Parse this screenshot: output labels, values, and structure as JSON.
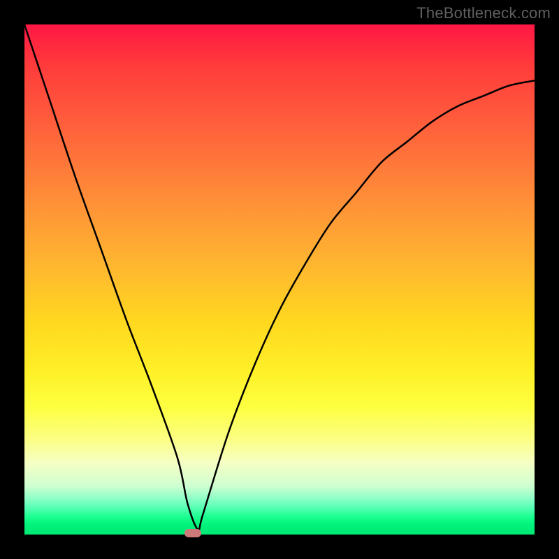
{
  "watermark": "TheBottleneck.com",
  "chart_data": {
    "type": "line",
    "title": "",
    "xlabel": "",
    "ylabel": "",
    "xlim": [
      0,
      100
    ],
    "ylim": [
      0,
      100
    ],
    "grid": false,
    "series": [
      {
        "name": "curve",
        "x": [
          0,
          5,
          10,
          15,
          20,
          25,
          30,
          32,
          34,
          35,
          40,
          45,
          50,
          55,
          60,
          65,
          70,
          75,
          80,
          85,
          90,
          95,
          100
        ],
        "y": [
          100,
          85,
          70,
          56,
          42,
          29,
          15,
          6,
          1,
          4,
          20,
          33,
          44,
          53,
          61,
          67,
          73,
          77,
          81,
          84,
          86,
          88,
          89
        ]
      }
    ],
    "marker": {
      "x": 33,
      "y": 0
    },
    "background": "vertical-gradient-red-to-green"
  },
  "frame": {
    "border_px": 35,
    "border_color": "#000000"
  }
}
